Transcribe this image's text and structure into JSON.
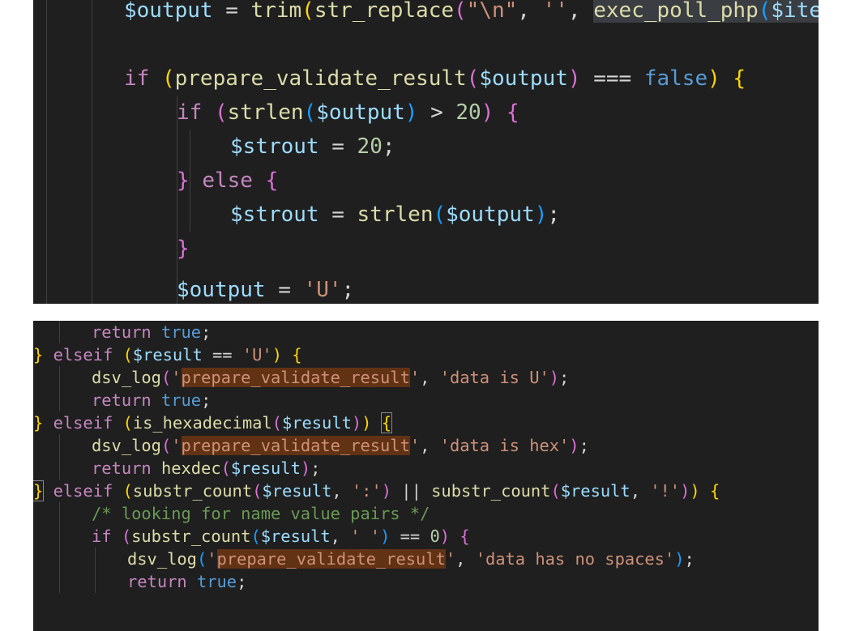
{
  "panel_top": {
    "lines": [
      [
        [
          "v",
          "$output"
        ],
        [
          "p",
          " = "
        ],
        [
          "f",
          "trim"
        ],
        [
          "y",
          "("
        ],
        [
          "f",
          "str_replace"
        ],
        [
          "m",
          "("
        ],
        [
          "s",
          "\"\\n\""
        ],
        [
          "p",
          ", "
        ],
        [
          "s",
          "''"
        ],
        [
          "p",
          ", "
        ],
        [
          "fg",
          "exec_poll_php"
        ],
        [
          "cg",
          "("
        ],
        [
          "vg",
          "$item"
        ],
        [
          "pg",
          "['"
        ]
      ],
      [],
      [
        [
          "k",
          "if"
        ],
        [
          "p",
          " "
        ],
        [
          "y",
          "("
        ],
        [
          "f",
          "prepare_validate_result"
        ],
        [
          "m",
          "("
        ],
        [
          "v",
          "$output"
        ],
        [
          "m",
          ")"
        ],
        [
          "p",
          " === "
        ],
        [
          "b",
          "false"
        ],
        [
          "y",
          ")"
        ],
        [
          "p",
          " "
        ],
        [
          "y",
          "{"
        ]
      ],
      [
        [
          "k",
          "if"
        ],
        [
          "p",
          " "
        ],
        [
          "m",
          "("
        ],
        [
          "f",
          "strlen"
        ],
        [
          "c",
          "("
        ],
        [
          "v",
          "$output"
        ],
        [
          "c",
          ")"
        ],
        [
          "p",
          " > "
        ],
        [
          "n",
          "20"
        ],
        [
          "m",
          ")"
        ],
        [
          "p",
          " "
        ],
        [
          "m",
          "{"
        ]
      ],
      [
        [
          "v",
          "$strout"
        ],
        [
          "p",
          " = "
        ],
        [
          "n",
          "20"
        ],
        [
          "p",
          ";"
        ]
      ],
      [
        [
          "m",
          "}"
        ],
        [
          "p",
          " "
        ],
        [
          "k",
          "else"
        ],
        [
          "p",
          " "
        ],
        [
          "m",
          "{"
        ]
      ],
      [
        [
          "v",
          "$strout"
        ],
        [
          "p",
          " = "
        ],
        [
          "f",
          "strlen"
        ],
        [
          "c",
          "("
        ],
        [
          "v",
          "$output"
        ],
        [
          "c",
          ")"
        ],
        [
          "p",
          ";"
        ]
      ],
      [
        [
          "m",
          "}"
        ]
      ],
      [],
      [
        [
          "v",
          "$output"
        ],
        [
          "p",
          " = "
        ],
        [
          "s",
          "'U'"
        ],
        [
          "p",
          ";"
        ]
      ]
    ]
  },
  "panel_bottom": {
    "lines": [
      [
        [
          "k",
          "return"
        ],
        [
          "p",
          " "
        ],
        [
          "b",
          "true"
        ],
        [
          "p",
          ";"
        ]
      ],
      [
        [
          "y",
          "}"
        ],
        [
          "p",
          " "
        ],
        [
          "k",
          "elseif"
        ],
        [
          "p",
          " "
        ],
        [
          "y",
          "("
        ],
        [
          "v",
          "$result"
        ],
        [
          "p",
          " == "
        ],
        [
          "s",
          "'U'"
        ],
        [
          "y",
          ")"
        ],
        [
          "p",
          " "
        ],
        [
          "y",
          "{"
        ]
      ],
      [
        [
          "f",
          "dsv_log"
        ],
        [
          "m",
          "("
        ],
        [
          "s",
          "'"
        ],
        [
          "sh",
          "prepare_validate_result"
        ],
        [
          "s",
          "'"
        ],
        [
          "p",
          ", "
        ],
        [
          "s",
          "'data is U'"
        ],
        [
          "m",
          ")"
        ],
        [
          "p",
          ";"
        ]
      ],
      [
        [
          "k",
          "return"
        ],
        [
          "p",
          " "
        ],
        [
          "b",
          "true"
        ],
        [
          "p",
          ";"
        ]
      ],
      [
        [
          "y",
          "}"
        ],
        [
          "p",
          " "
        ],
        [
          "k",
          "elseif"
        ],
        [
          "p",
          " "
        ],
        [
          "y",
          "("
        ],
        [
          "f",
          "is_hexadecimal"
        ],
        [
          "m",
          "("
        ],
        [
          "v",
          "$result"
        ],
        [
          "m",
          ")"
        ],
        [
          "y",
          ")"
        ],
        [
          "p",
          " "
        ],
        [
          "yb",
          "{"
        ]
      ],
      [
        [
          "f",
          "dsv_log"
        ],
        [
          "m",
          "("
        ],
        [
          "s",
          "'"
        ],
        [
          "sh",
          "prepare_validate_result"
        ],
        [
          "s",
          "'"
        ],
        [
          "p",
          ", "
        ],
        [
          "s",
          "'data is hex'"
        ],
        [
          "m",
          ")"
        ],
        [
          "p",
          ";"
        ]
      ],
      [
        [
          "k",
          "return"
        ],
        [
          "p",
          " "
        ],
        [
          "f",
          "hexdec"
        ],
        [
          "m",
          "("
        ],
        [
          "v",
          "$result"
        ],
        [
          "m",
          ")"
        ],
        [
          "p",
          ";"
        ]
      ],
      [
        [
          "yb",
          "}"
        ],
        [
          "p",
          " "
        ],
        [
          "k",
          "elseif"
        ],
        [
          "p",
          " "
        ],
        [
          "y",
          "("
        ],
        [
          "f",
          "substr_count"
        ],
        [
          "m",
          "("
        ],
        [
          "v",
          "$result"
        ],
        [
          "p",
          ", "
        ],
        [
          "s",
          "':'"
        ],
        [
          "m",
          ")"
        ],
        [
          "p",
          " || "
        ],
        [
          "f",
          "substr_count"
        ],
        [
          "m",
          "("
        ],
        [
          "v",
          "$result"
        ],
        [
          "p",
          ", "
        ],
        [
          "s",
          "'!'"
        ],
        [
          "m",
          ")"
        ],
        [
          "y",
          ")"
        ],
        [
          "p",
          " "
        ],
        [
          "y",
          "{"
        ]
      ],
      [
        [
          "cm",
          "/* looking for name value pairs */"
        ]
      ],
      [
        [
          "k",
          "if"
        ],
        [
          "p",
          " "
        ],
        [
          "m",
          "("
        ],
        [
          "f",
          "substr_count"
        ],
        [
          "c",
          "("
        ],
        [
          "v",
          "$result"
        ],
        [
          "p",
          ", "
        ],
        [
          "s",
          "' '"
        ],
        [
          "c",
          ")"
        ],
        [
          "p",
          " == "
        ],
        [
          "n",
          "0"
        ],
        [
          "m",
          ")"
        ],
        [
          "p",
          " "
        ],
        [
          "m",
          "{"
        ]
      ],
      [
        [
          "f",
          "dsv_log"
        ],
        [
          "c",
          "("
        ],
        [
          "s",
          "'"
        ],
        [
          "sh",
          "prepare_validate_result"
        ],
        [
          "s",
          "'"
        ],
        [
          "p",
          ", "
        ],
        [
          "s",
          "'data has no spaces'"
        ],
        [
          "c",
          ")"
        ],
        [
          "p",
          ";"
        ]
      ],
      [
        [
          "k",
          "return"
        ],
        [
          "p",
          " "
        ],
        [
          "b",
          "true"
        ],
        [
          "p",
          ";"
        ]
      ]
    ]
  }
}
